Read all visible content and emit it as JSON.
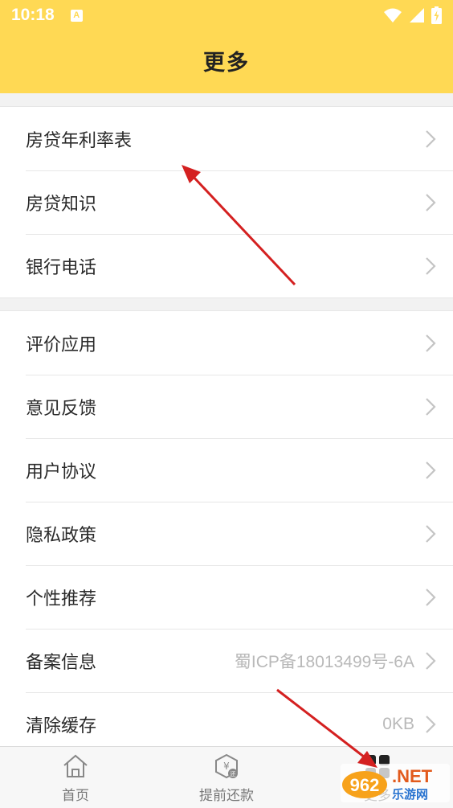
{
  "status_bar": {
    "time": "10:18",
    "badge": "A"
  },
  "header": {
    "title": "更多"
  },
  "groups": [
    {
      "items": [
        {
          "label": "房贷年利率表"
        },
        {
          "label": "房贷知识"
        },
        {
          "label": "银行电话"
        }
      ]
    },
    {
      "items": [
        {
          "label": "评价应用"
        },
        {
          "label": "意见反馈"
        },
        {
          "label": "用户协议"
        },
        {
          "label": "隐私政策"
        },
        {
          "label": "个性推荐"
        },
        {
          "label": "备案信息",
          "value": "蜀ICP备18013499号-6A"
        },
        {
          "label": "清除缓存",
          "value": "0KB"
        }
      ]
    }
  ],
  "tabbar": {
    "tabs": [
      {
        "label": "首页",
        "icon": "home-icon"
      },
      {
        "label": "提前还款",
        "icon": "repayment-icon"
      },
      {
        "label": "更多",
        "icon": "grid-icon"
      }
    ]
  },
  "watermark": {
    "brand": "962",
    "net": ".NET",
    "cn": "乐游网"
  },
  "colors": {
    "header_bg": "#ffd954",
    "annotation_arrow": "#d42020",
    "watermark_orange": "#e25a1c",
    "watermark_blue": "#2a74d0"
  }
}
